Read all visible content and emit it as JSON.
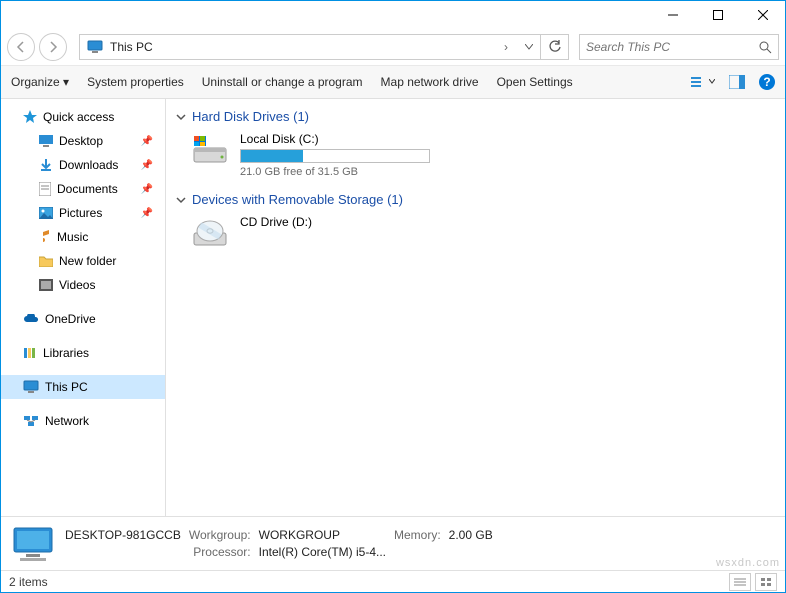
{
  "titlebar": {
    "minimize": "—",
    "maximize": "☐",
    "close": "✕"
  },
  "navbar": {
    "location": "This PC",
    "chevron": "›",
    "search_placeholder": "Search This PC"
  },
  "toolbar": {
    "organize": "Organize",
    "system_properties": "System properties",
    "uninstall": "Uninstall or change a program",
    "map_drive": "Map network drive",
    "open_settings": "Open Settings"
  },
  "nav_pane": {
    "quick_access": "Quick access",
    "desktop": "Desktop",
    "downloads": "Downloads",
    "documents": "Documents",
    "pictures": "Pictures",
    "music": "Music",
    "new_folder": "New folder",
    "videos": "Videos",
    "onedrive": "OneDrive",
    "libraries": "Libraries",
    "this_pc": "This PC",
    "network": "Network"
  },
  "content": {
    "group1": {
      "title": "Hard Disk Drives (1)"
    },
    "drive1": {
      "name": "Local Disk (C:)",
      "free_text": "21.0 GB free of 31.5 GB",
      "fill_percent": 33
    },
    "group2": {
      "title": "Devices with Removable Storage (1)"
    },
    "drive2": {
      "name": "CD Drive (D:)"
    }
  },
  "details": {
    "computer_name": "DESKTOP-981GCCB",
    "workgroup_label": "Workgroup:",
    "workgroup": "WORKGROUP",
    "memory_label": "Memory:",
    "memory": "2.00 GB",
    "processor_label": "Processor:",
    "processor": "Intel(R) Core(TM) i5-4..."
  },
  "statusbar": {
    "items": "2 items"
  },
  "watermark": "wsxdn.com"
}
